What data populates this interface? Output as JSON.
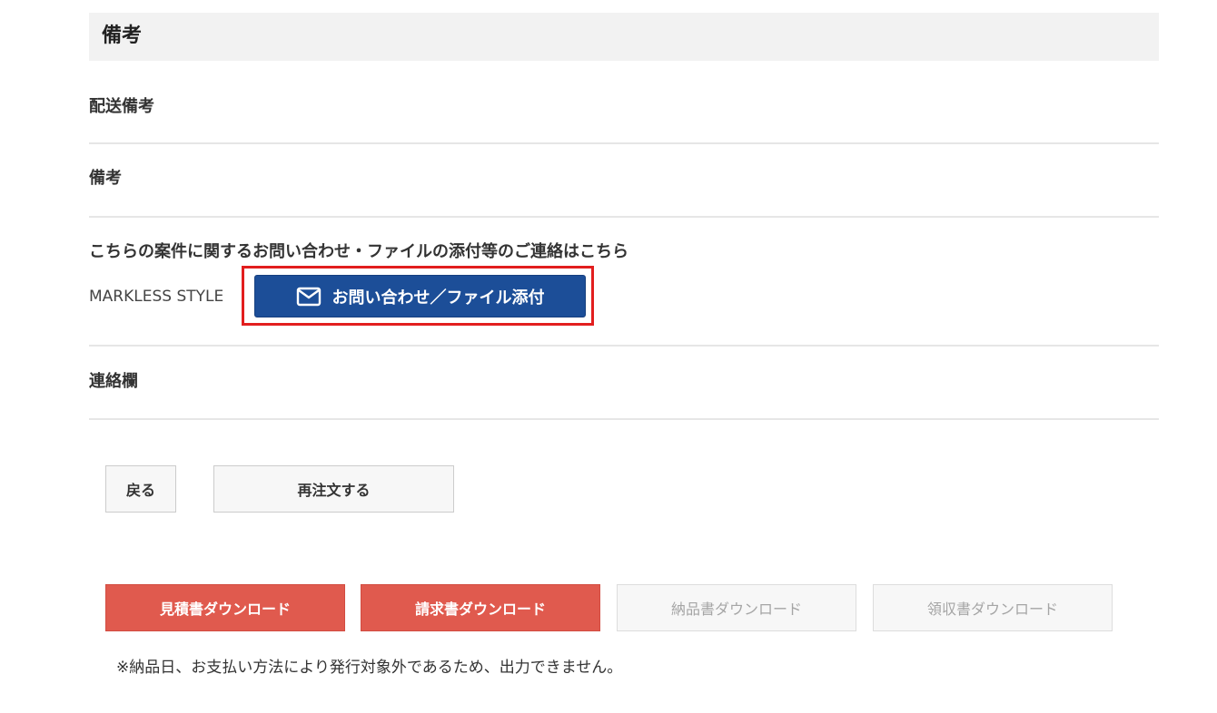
{
  "section": {
    "title": "備考"
  },
  "fields": {
    "shipping_note_label": "配送備考",
    "remarks_label": "備考",
    "inquiry_label": "こちらの案件に関するお問い合わせ・ファイルの添付等のご連絡はこちら",
    "store_name": "MARKLESS STYLE",
    "inquiry_button_label": "お問い合わせ／ファイル添付",
    "inquiry_button_icon": "mail-icon",
    "contact_label": "連絡欄"
  },
  "actions": {
    "back_label": "戻る",
    "reorder_label": "再注文する"
  },
  "documents": {
    "estimate_label": "見積書ダウンロード",
    "invoice_label": "請求書ダウンロード",
    "delivery_label": "納品書ダウンロード",
    "receipt_label": "領収書ダウンロード"
  },
  "note": "※納品日、お支払い方法により発行対象外であるため、出力できません。",
  "colors": {
    "primary_button": "#1c4e98",
    "download_active": "#e05a4e",
    "highlight_border": "#e21e1e"
  }
}
